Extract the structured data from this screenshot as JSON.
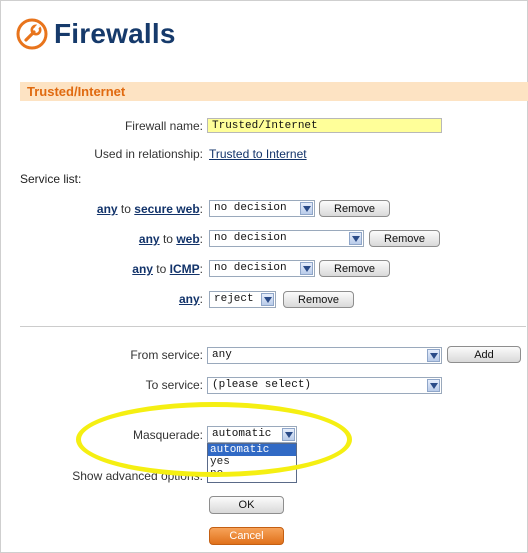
{
  "page": {
    "title": "Firewalls",
    "section": "Trusted/Internet"
  },
  "form": {
    "firewall_name_label": "Firewall name:",
    "firewall_name_value": "Trusted/Internet",
    "used_in_label": "Used in relationship:",
    "used_in_link": "Trusted to Internet",
    "service_list_label": "Service list:"
  },
  "rules": [
    {
      "from": "any",
      "to_word": "to",
      "to": "secure web",
      "decision": "no decision",
      "remove": "Remove"
    },
    {
      "from": "any",
      "to_word": "to",
      "to": "web",
      "decision": "no decision",
      "remove": "Remove"
    },
    {
      "from": "any",
      "to_word": "to",
      "to": "ICMP",
      "decision": "no decision",
      "remove": "Remove"
    },
    {
      "from": "any",
      "decision": "reject",
      "remove": "Remove"
    }
  ],
  "add": {
    "from_label": "From service:",
    "from_value": "any",
    "add_button": "Add",
    "to_label": "To service:",
    "to_value": "(please select)"
  },
  "masquerade": {
    "label": "Masquerade:",
    "value": "automatic",
    "options": [
      "automatic",
      "yes",
      "no"
    ],
    "highlighted": "automatic"
  },
  "advanced": {
    "label": "Show advanced options:"
  },
  "buttons": {
    "ok": "OK",
    "cancel": "Cancel"
  },
  "colors": {
    "title": "#163a6b",
    "section_bg": "#fde3c3",
    "section_text": "#e06a10",
    "name_bg": "#ffff99",
    "highlight": "#f5ef12",
    "cancel": "#e0711b"
  },
  "icons": {
    "title_icon": "wrench-circle-icon",
    "dropdown_arrow": "chevron-down-icon"
  }
}
